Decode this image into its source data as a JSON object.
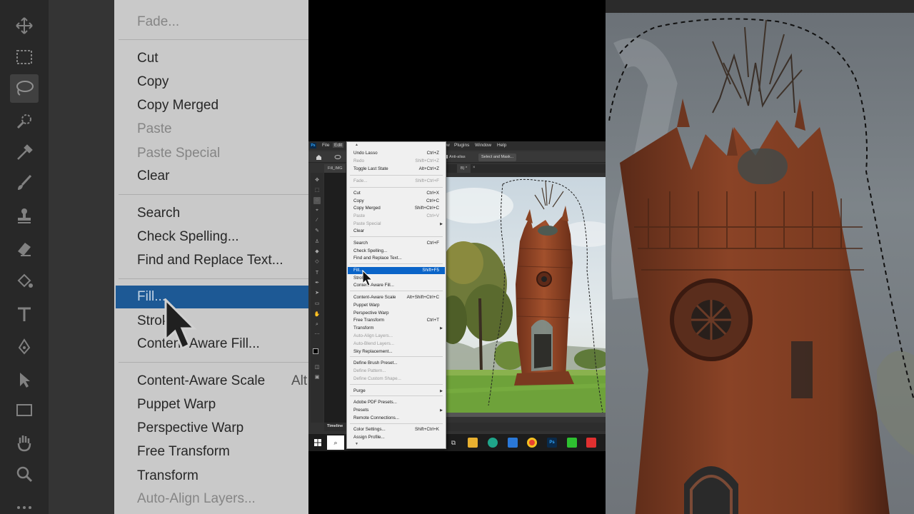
{
  "left_zoom": {
    "items": [
      {
        "label": "Fade...",
        "disabled": true
      },
      {
        "label": "Cut",
        "disabled": false
      },
      {
        "label": "Copy",
        "disabled": false
      },
      {
        "label": "Copy Merged",
        "disabled": false
      },
      {
        "label": "Paste",
        "disabled": true
      },
      {
        "label": "Paste Special",
        "disabled": true
      },
      {
        "label": "Clear",
        "disabled": false
      },
      {
        "label": "Search",
        "disabled": false
      },
      {
        "label": "Check Spelling...",
        "disabled": false
      },
      {
        "label": "Find and Replace Text...",
        "disabled": false
      },
      {
        "label": "Fill...",
        "disabled": false
      },
      {
        "label": "Strok",
        "disabled": false
      },
      {
        "label": "Content-Aware Fill...",
        "disabled": false
      },
      {
        "label": "Content-Aware Scale",
        "disabled": false
      },
      {
        "label": "Puppet Warp",
        "disabled": false
      },
      {
        "label": "Perspective Warp",
        "disabled": false
      },
      {
        "label": "Free Transform",
        "disabled": false
      },
      {
        "label": "Transform",
        "disabled": false
      },
      {
        "label": "Auto-Align Layers...",
        "disabled": true
      }
    ],
    "shortcut_fragment": "Alt"
  },
  "menubar": {
    "file": "File",
    "edit": "Edit",
    "w": "w",
    "plugins": "Plugins",
    "window": "Window",
    "help": "Help"
  },
  "options": {
    "logo": "Ps",
    "anti_alias": "Anti-alias",
    "select_mask": "Select and Mask..."
  },
  "tabs": {
    "doc_left": "Fill_IMG",
    "doc_right": "B) *"
  },
  "timeline": "Timeline",
  "edit_menu": {
    "items": [
      {
        "label": "Undo Lasso",
        "shortcut": "Ctrl+Z",
        "disabled": false
      },
      {
        "label": "Redo",
        "shortcut": "Shift+Ctrl+Z",
        "disabled": true
      },
      {
        "label": "Toggle Last State",
        "shortcut": "Alt+Ctrl+Z",
        "disabled": false
      },
      {
        "label": "Fade...",
        "shortcut": "Shift+Ctrl+F",
        "disabled": true
      },
      {
        "label": "Cut",
        "shortcut": "Ctrl+X",
        "disabled": false
      },
      {
        "label": "Copy",
        "shortcut": "Ctrl+C",
        "disabled": false
      },
      {
        "label": "Copy Merged",
        "shortcut": "Shift+Ctrl+C",
        "disabled": false
      },
      {
        "label": "Paste",
        "shortcut": "Ctrl+V",
        "disabled": true
      },
      {
        "label": "Paste Special",
        "shortcut": "",
        "disabled": true
      },
      {
        "label": "Clear",
        "shortcut": "",
        "disabled": false
      },
      {
        "label": "Search",
        "shortcut": "Ctrl+F",
        "disabled": false
      },
      {
        "label": "Check Spelling...",
        "shortcut": "",
        "disabled": false
      },
      {
        "label": "Find and Replace Text...",
        "shortcut": "",
        "disabled": false
      },
      {
        "label": "Fill...",
        "shortcut": "Shift+F5",
        "disabled": false
      },
      {
        "label": "Stroke...",
        "shortcut": "",
        "disabled": false
      },
      {
        "label": "Content-Aware Fill...",
        "shortcut": "",
        "disabled": false
      },
      {
        "label": "Content-Aware Scale",
        "shortcut": "Alt+Shift+Ctrl+C",
        "disabled": false
      },
      {
        "label": "Puppet Warp",
        "shortcut": "",
        "disabled": false
      },
      {
        "label": "Perspective Warp",
        "shortcut": "",
        "disabled": false
      },
      {
        "label": "Free Transform",
        "shortcut": "Ctrl+T",
        "disabled": false
      },
      {
        "label": "Transform",
        "shortcut": "",
        "disabled": false
      },
      {
        "label": "Auto-Align Layers...",
        "shortcut": "",
        "disabled": true
      },
      {
        "label": "Auto-Blend Layers...",
        "shortcut": "",
        "disabled": true
      },
      {
        "label": "Sky Replacement...",
        "shortcut": "",
        "disabled": false
      },
      {
        "label": "Define Brush Preset...",
        "shortcut": "",
        "disabled": false
      },
      {
        "label": "Define Pattern...",
        "shortcut": "",
        "disabled": true
      },
      {
        "label": "Define Custom Shape...",
        "shortcut": "",
        "disabled": true
      },
      {
        "label": "Purge",
        "shortcut": "",
        "disabled": false
      },
      {
        "label": "Adobe PDF Presets...",
        "shortcut": "",
        "disabled": false
      },
      {
        "label": "Presets",
        "shortcut": "",
        "disabled": false
      },
      {
        "label": "Remote Connections...",
        "shortcut": "",
        "disabled": false
      },
      {
        "label": "Color Settings...",
        "shortcut": "Shift+Ctrl+K",
        "disabled": false
      },
      {
        "label": "Assign Profile...",
        "shortcut": "",
        "disabled": false
      }
    ],
    "highlighted": "Fill..."
  },
  "taskbar": {
    "photoshop": "Ps"
  },
  "colors": {
    "highlight": "#0a64c8",
    "brick": "#9a4a2a",
    "photoshop_blue": "#31a8ff"
  }
}
